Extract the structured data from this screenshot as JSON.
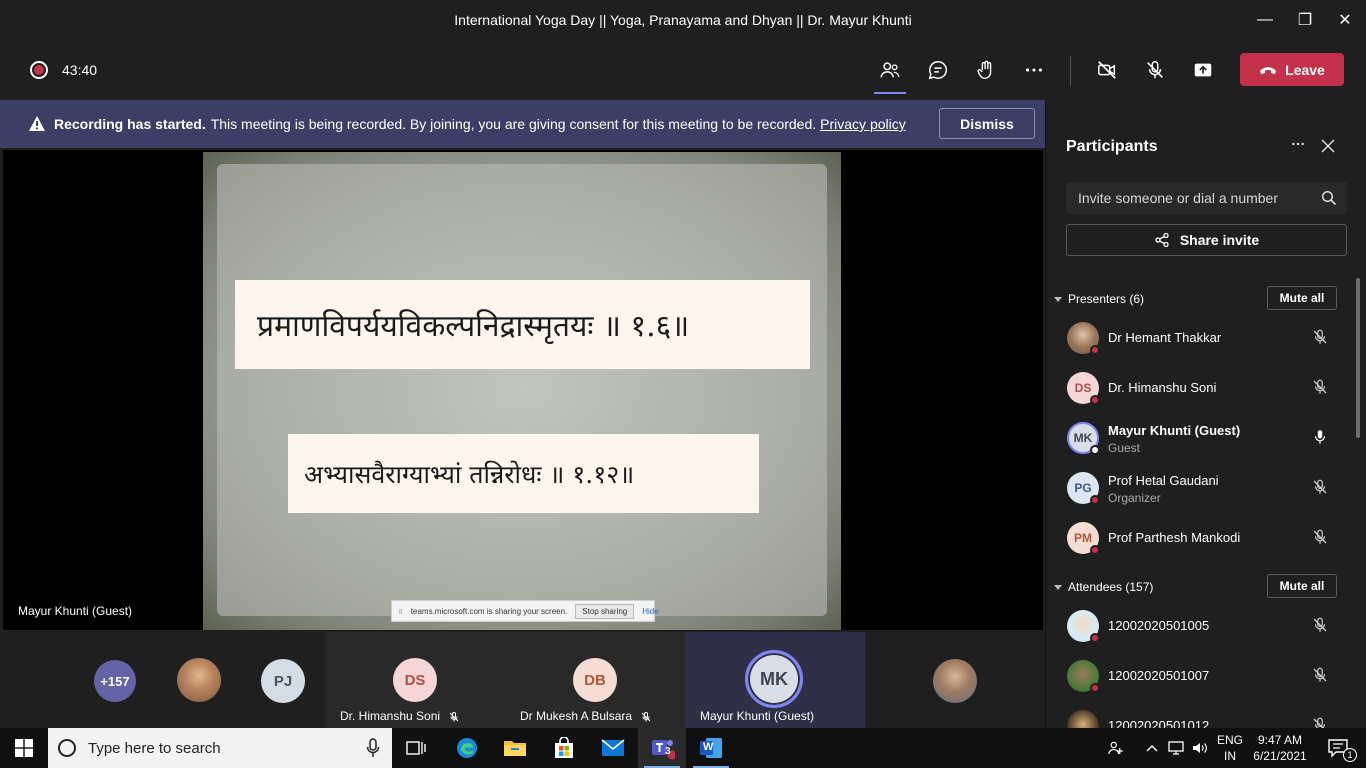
{
  "window": {
    "title": "International Yoga Day || Yoga, Pranayama and Dhyan || Dr. Mayur Khunti",
    "minimize_glyph": "—",
    "restore_glyph": "❐",
    "close_glyph": "✕"
  },
  "toolbar": {
    "timer": "43:40",
    "leave_label": "Leave",
    "icons": [
      "people-icon",
      "chat-icon",
      "raise-hand-icon",
      "more-icon",
      "camera-off-icon",
      "mic-off-icon",
      "share-tray-icon"
    ]
  },
  "banner": {
    "title": "Recording has started.",
    "message": "This meeting is being recorded. By joining, you are giving consent for this meeting to be recorded.",
    "link": "Privacy policy",
    "dismiss_label": "Dismiss"
  },
  "stage": {
    "slide_line1": "प्रमाणविपर्ययविकल्पनिद्रास्मृतयः ॥ १.६॥",
    "slide_line2": "अभ्यासवैराग्याभ्यां तन्निरोधः ॥ १.१२॥",
    "share_text": "teams.microsoft.com is sharing your screen.",
    "stop_sharing": "Stop sharing",
    "hide": "Hide",
    "presenter_label": "Mayur Khunti (Guest)"
  },
  "strip": {
    "overflow_count": "+157",
    "pj_initials": "PJ",
    "tiles": [
      {
        "initials": "DS",
        "name": "Dr. Himanshu Soni"
      },
      {
        "initials": "DB",
        "name": "Dr Mukesh A Bulsara"
      },
      {
        "initials": "MK",
        "name": "Mayur Khunti (Guest)"
      }
    ]
  },
  "panel": {
    "title": "Participants",
    "invite_placeholder": "Invite someone or dial a number",
    "share_invite": "Share invite",
    "presenters_header": "Presenters (6)",
    "attendees_header": "Attendees (157)",
    "mute_all": "Mute all",
    "presenters": [
      {
        "initials": "",
        "name": "Dr Hemant Thakkar",
        "role": ""
      },
      {
        "initials": "DS",
        "name": "Dr. Himanshu Soni",
        "role": ""
      },
      {
        "initials": "MK",
        "name": "Mayur Khunti (Guest)",
        "role": "Guest"
      },
      {
        "initials": "PG",
        "name": "Prof Hetal Gaudani",
        "role": "Organizer"
      },
      {
        "initials": "PM",
        "name": "Prof Parthesh Mankodi",
        "role": ""
      }
    ],
    "attendees": [
      {
        "name": "12002020501005"
      },
      {
        "name": "12002020501007"
      },
      {
        "name": "12002020501012"
      }
    ]
  },
  "taskbar": {
    "search_placeholder": "Type here to search",
    "lang": "ENG",
    "region": "IN",
    "time": "9:47 AM",
    "date": "6/21/2021",
    "teams_badge": "3",
    "notif_badge": "1",
    "word_glyph": "W"
  }
}
